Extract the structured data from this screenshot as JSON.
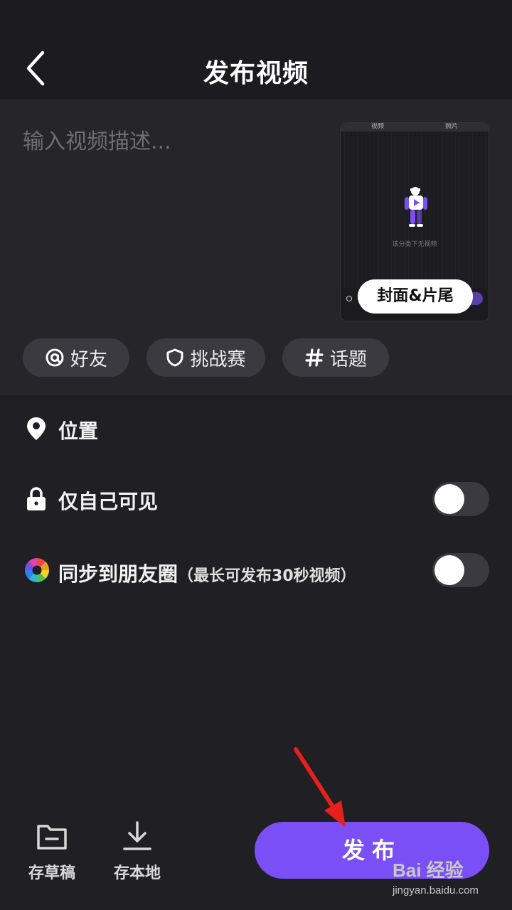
{
  "header": {
    "title": "发布视频"
  },
  "compose": {
    "description_placeholder": "输入视频描述...",
    "description_value": "",
    "cover": {
      "tab_left": "视频",
      "tab_right": "照片",
      "empty_text": "该分类下无视频",
      "button_label": "封面&片尾"
    },
    "chips": [
      {
        "icon": "at-icon",
        "label": "好友"
      },
      {
        "icon": "shield-icon",
        "label": "挑战赛"
      },
      {
        "icon": "hashtag-icon",
        "label": "话题"
      }
    ]
  },
  "options": {
    "location": {
      "icon": "location-pin-icon",
      "label": "位置"
    },
    "private": {
      "icon": "lock-icon",
      "label": "仅自己可见",
      "enabled": false
    },
    "moments": {
      "icon": "moments-icon",
      "label": "同步到朋友圈",
      "note": "（最长可发布30秒视频）",
      "enabled": false
    }
  },
  "footer": {
    "draft_label": "存草稿",
    "save_local_label": "存本地",
    "publish_label": "发布"
  },
  "watermark": {
    "brand": "Bai 经验",
    "url": "jingyan.baidu.com"
  },
  "colors": {
    "accent": "#7a4ff5",
    "background": "#1f1f24",
    "panel": "#25252a",
    "annotation_arrow": "#e8201c"
  }
}
